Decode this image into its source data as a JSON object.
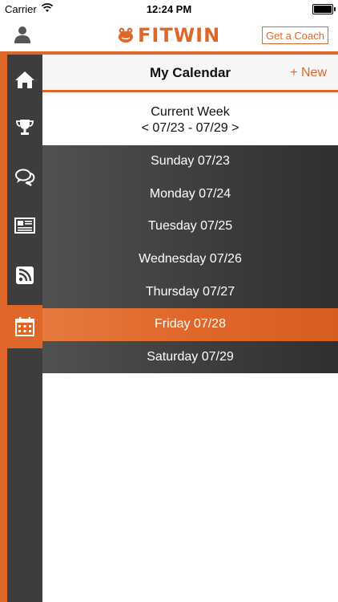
{
  "status": {
    "carrier": "Carrier",
    "time": "12:24 PM"
  },
  "brand": {
    "name": "FITWIN",
    "accent": "#e0672a"
  },
  "top_nav": {
    "coach_label": "Get a Coach"
  },
  "sidebar": {
    "items": [
      {
        "icon": "home-icon",
        "active": false
      },
      {
        "icon": "trophy-icon",
        "active": false
      },
      {
        "icon": "chat-icon",
        "active": false
      },
      {
        "icon": "newspaper-icon",
        "active": false
      },
      {
        "icon": "rss-icon",
        "active": false
      },
      {
        "icon": "calendar-icon",
        "active": true
      }
    ]
  },
  "header": {
    "title": "My Calendar",
    "new_label": "+ New"
  },
  "week": {
    "label": "Current Week",
    "range": "< 07/23 - 07/29 >"
  },
  "days": [
    {
      "label": "Sunday 07/23",
      "selected": false
    },
    {
      "label": "Monday 07/24",
      "selected": false
    },
    {
      "label": "Tuesday 07/25",
      "selected": false
    },
    {
      "label": "Wednesday 07/26",
      "selected": false
    },
    {
      "label": "Thursday 07/27",
      "selected": false
    },
    {
      "label": "Friday 07/28",
      "selected": true
    },
    {
      "label": "Saturday 07/29",
      "selected": false
    }
  ]
}
